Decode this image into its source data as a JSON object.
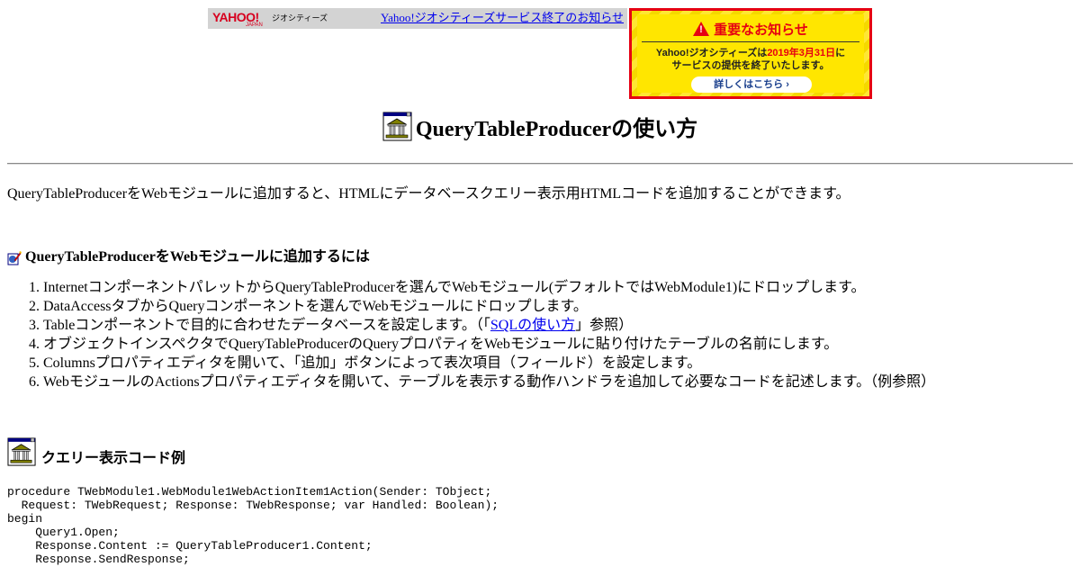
{
  "banner": {
    "logo_yahoo": "YAHOO!",
    "logo_japan": "JAPAN",
    "logo_geo": "ジオシティーズ",
    "link_text": "Yahoo!ジオシティーズサービス終了のお知らせ"
  },
  "notice": {
    "title": "重要なお知らせ",
    "line1_pre": "Yahoo!ジオシティーズは",
    "line1_date": "2019年3月31日",
    "line1_post": "に",
    "line2": "サービスの提供を終了いたします。",
    "button": "詳しくはこちら ›"
  },
  "page": {
    "title": "QueryTableProducerの使い方",
    "intro": "QueryTableProducerをWebモジュールに追加すると、HTMLにデータベースクエリー表示用HTMLコードを追加することができます。"
  },
  "section1": {
    "heading": "QueryTableProducerをWebモジュールに追加するには",
    "steps": [
      "Internetコンポーネントパレットからquery",
      "",
      "",
      "",
      "",
      ""
    ],
    "step1": "InternetコンポーネントパレットからQueryTableProducerを選んでWebモジュール(デフォルトではWebModule1)にドロップします。",
    "step2": "DataAccessタブからQueryコンポーネントを選んでWebモジュールにドロップします。",
    "step3_pre": "Tableコンポーネントで目的に合わせたデータベースを設定します。（「",
    "step3_link": "SQLの使い方",
    "step3_post": "」参照）",
    "step4": "オブジェクトインスペクタでQueryTableProducerのQueryプロパティをWebモジュールに貼り付けたテーブルの名前にします。",
    "step5": "Columnsプロパティエディタを開いて、「追加」ボタンによって表次項目（フィールド）を設定します。",
    "step6": "WebモジュールのActionsプロパティエディタを開いて、テーブルを表示する動作ハンドラを追加して必要なコードを記述します。（例参照）"
  },
  "section2": {
    "heading": "クエリー表示コード例",
    "code": "procedure TWebModule1.WebModule1WebActionItem1Action(Sender: TObject;\n  Request: TWebRequest; Response: TWebResponse; var Handled: Boolean);\nbegin\n    Query1.Open;\n    Response.Content := QueryTableProducer1.Content;\n    Response.SendResponse;"
  },
  "colors": {
    "link": "#0000ee",
    "notice_red": "#e60012",
    "notice_yellow": "#ffe600",
    "banner_gray": "#d3d3d3"
  },
  "icons": [
    "bank-building-icon",
    "pencil-doc-icon"
  ]
}
